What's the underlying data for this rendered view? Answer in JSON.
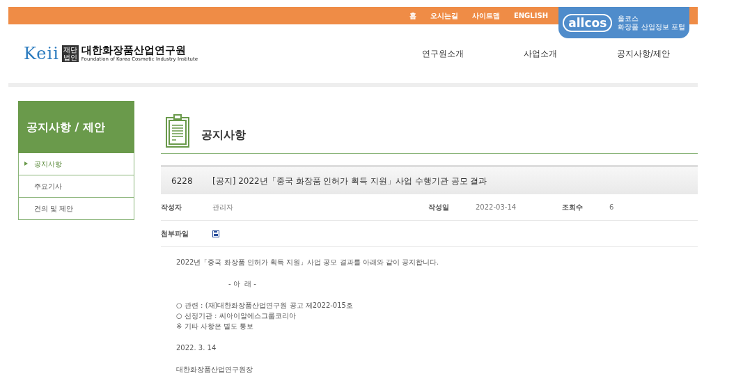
{
  "top_links": [
    "홈",
    "오시는길",
    "사이트맵",
    "ENGLISH"
  ],
  "allcos": {
    "logo": "allcos",
    "name": "올코스",
    "subtitle": "화장품 산업정보 포털"
  },
  "logo": {
    "mark": "Keii",
    "badge": "재단법인",
    "name": "대한화장품산업연구원",
    "english": "Foundation of Korea Cosmetic Industry Institute"
  },
  "main_nav": [
    "연구원소개",
    "사업소개",
    "공지사항/제안"
  ],
  "sidebar": {
    "title": "공지사항 / 제안",
    "items": [
      {
        "label": "공지사항",
        "selected": true
      },
      {
        "label": "주요기사",
        "selected": false
      },
      {
        "label": "건의 및 제안",
        "selected": false
      }
    ]
  },
  "page_title": "공지사항",
  "post": {
    "number": "6228",
    "title": "[공지] 2022년「중국 화장품 인허가 획득 지원」사업 수행기관 공모 결과",
    "meta": [
      {
        "label": "작성자",
        "value": "관리자"
      },
      {
        "label": "작성일",
        "value": "2022-03-14"
      },
      {
        "label": "조회수",
        "value": "6"
      }
    ],
    "attachment_label": "첨부파일",
    "body": [
      {
        "kind": "para",
        "text": "2022년「중국 화장품 인허가 획득 지원」사업 공모 결과를 아래와 같이 공지합니다."
      },
      {
        "kind": "center",
        "text": "- 아  래 -"
      },
      {
        "kind": "list",
        "lines": [
          "○ 관련 : (재)대한화장품산업연구원 공고 제2022-015호",
          "○ 선정기관 : 씨아이알에스그룹코리아",
          "※ 기타 사항은 별도 통보"
        ]
      },
      {
        "kind": "para",
        "text": "2022. 3. 14"
      },
      {
        "kind": "para",
        "text": "대한화장품산업연구원장"
      }
    ]
  }
}
